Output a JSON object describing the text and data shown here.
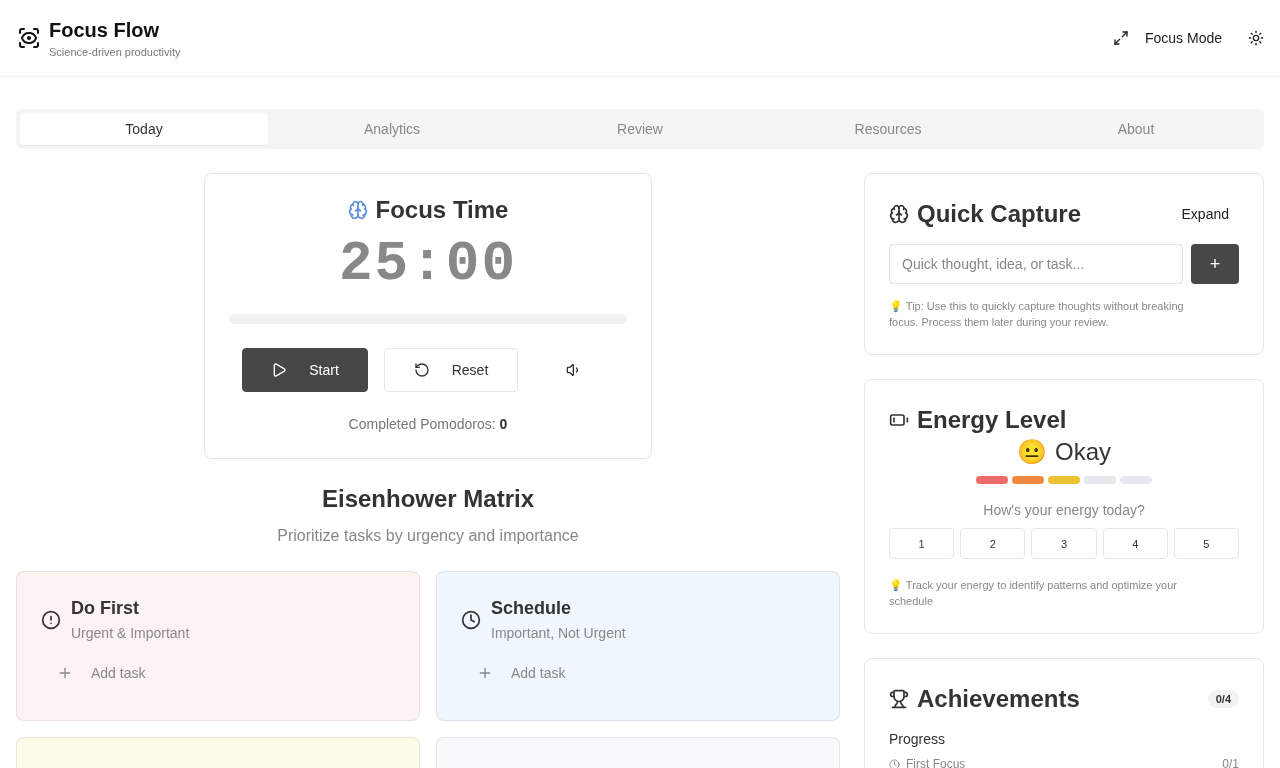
{
  "header": {
    "title": "Focus Flow",
    "subtitle": "Science-driven productivity",
    "focus_mode": "Focus Mode"
  },
  "tabs": [
    {
      "label": "Today",
      "selected": true
    },
    {
      "label": "Analytics",
      "selected": false
    },
    {
      "label": "Review",
      "selected": false
    },
    {
      "label": "Resources",
      "selected": false
    },
    {
      "label": "About",
      "selected": false
    }
  ],
  "timer": {
    "title": "Focus Time",
    "time": "25:00",
    "start": "Start",
    "reset": "Reset",
    "completed_label": "Completed Pomodoros: ",
    "completed": "0"
  },
  "matrix": {
    "title": "Eisenhower Matrix",
    "subtitle": "Prioritize tasks by urgency and importance",
    "quadrants": [
      {
        "kind": "alert",
        "color": "#fdf3f2",
        "title": "Do First",
        "subtitle": "Urgent & Important",
        "add": "Add task"
      },
      {
        "kind": "clock",
        "color": "#eff6fd",
        "title": "Schedule",
        "subtitle": "Important, Not Urgent",
        "add": "Add task"
      },
      {
        "color": "#fefce9"
      },
      {
        "color": "#f8f9fa"
      }
    ]
  },
  "quick_capture": {
    "title": "Quick Capture",
    "expand": "Expand",
    "placeholder": "Quick thought, idea, or task...",
    "add": "+",
    "tip": "💡 Tip: Use this to quickly capture thoughts without breaking focus. Process them later during your review."
  },
  "energy": {
    "title": "Energy Level",
    "emoji": "😐",
    "mood": "Okay",
    "segments": [
      {
        "color": "#ef6b6b"
      },
      {
        "color": "#f0893f"
      },
      {
        "color": "#ecc232"
      },
      {
        "color": "#e8e8ec"
      },
      {
        "color": "#e8e8ec"
      }
    ],
    "question": "How's your energy today?",
    "ratings": [
      {
        "label": "1",
        "selected": false
      },
      {
        "label": "2",
        "selected": false
      },
      {
        "label": "3",
        "selected": false
      },
      {
        "label": "4",
        "selected": false
      },
      {
        "label": "5",
        "selected": false
      }
    ],
    "tip": "💡 Track your energy to identify patterns and optimize your schedule"
  },
  "achievements": {
    "title": "Achievements",
    "count": "0/4",
    "progress_label": "Progress",
    "items": [
      {
        "name": "First Focus",
        "progress": "0/1",
        "unlocked": false
      }
    ]
  }
}
